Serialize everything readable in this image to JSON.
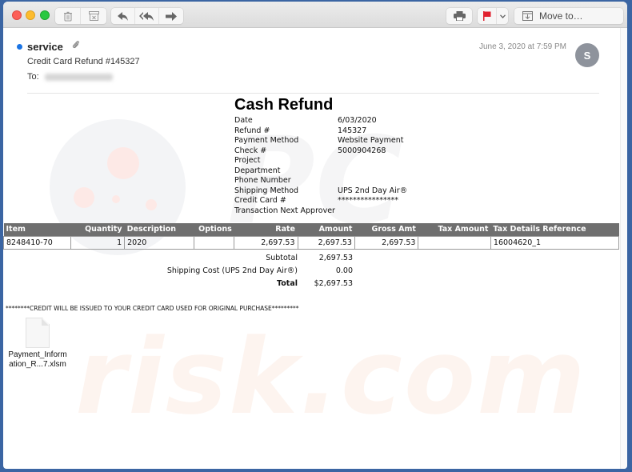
{
  "toolbar": {
    "buttons": {
      "delete": "trash-icon",
      "archive": "archive-icon",
      "reply": "reply-icon",
      "reply_all": "reply-all-icon",
      "forward": "forward-icon",
      "print": "print-icon",
      "flag": "flag-icon",
      "flag_menu": "chevron-down-icon"
    },
    "move_to_label": "Move to…",
    "flag_color": "#e0212f"
  },
  "message": {
    "sender": "service",
    "has_attachment": true,
    "subject": "Credit Card Refund #145327",
    "to_label": "To:",
    "date": "June 3, 2020 at 7:59 PM",
    "avatar_initial": "S",
    "unread_dot_color": "#1b74e4"
  },
  "document": {
    "title": "Cash Refund",
    "fields": [
      {
        "label": "Date",
        "value": "6/03/2020"
      },
      {
        "label": "Refund #",
        "value": "145327"
      },
      {
        "label": "Payment Method",
        "value": "Website Payment"
      },
      {
        "label": "Check #",
        "value": "5000904268"
      },
      {
        "label": "Project",
        "value": ""
      },
      {
        "label": "Department",
        "value": ""
      },
      {
        "label": "Phone Number",
        "value": ""
      },
      {
        "label": "Shipping Method",
        "value": "UPS 2nd Day Air®"
      },
      {
        "label": "Credit Card #",
        "value": "****************"
      },
      {
        "label": "Transaction Next Approver",
        "value": ""
      }
    ],
    "table": {
      "headers": [
        "Item",
        "Quantity",
        "Description",
        "Options",
        "Rate",
        "Amount",
        "Gross Amt",
        "Tax Amount",
        "Tax Details Reference"
      ],
      "rows": [
        [
          "8248410-70",
          "1",
          "2020",
          "",
          "2,697.53",
          "2,697.53",
          "2,697.53",
          "",
          "16004620_1"
        ]
      ]
    },
    "totals": [
      {
        "label": "Subtotal",
        "value": "2,697.53",
        "bold": false
      },
      {
        "label": "Shipping Cost (UPS 2nd Day Air®)",
        "value": "0.00",
        "bold": false
      },
      {
        "label": "Total",
        "value": "$2,697.53",
        "bold": true
      }
    ],
    "notice": "********CREDIT WILL BE ISSUED TO YOUR CREDIT CARD USED FOR ORIGINAL PURCHASE*********"
  },
  "attachment": {
    "name_line1": "Payment_Inform",
    "name_line2": "ation_R...7.xlsm",
    "icon": "document-icon"
  }
}
